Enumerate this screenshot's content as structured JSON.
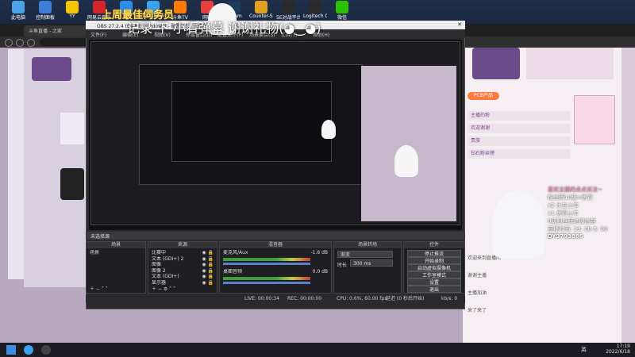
{
  "desktop_icons": [
    {
      "label": "此电脑",
      "name": "this-pc-icon",
      "color": "#4aa3e8"
    },
    {
      "label": "控制面板",
      "name": "control-panel-icon",
      "color": "#3d7fd8"
    },
    {
      "label": "YY",
      "name": "yy-icon",
      "color": "#f7c400"
    },
    {
      "label": "网易云音乐",
      "name": "netease-music-icon",
      "color": "#d8232a"
    },
    {
      "label": "",
      "name": "app-icon",
      "color": "#2a8ee8"
    },
    {
      "label": "WeGame",
      "name": "wegame-icon",
      "color": "#3aa0f0"
    },
    {
      "label": "斗鱼TV",
      "name": "douyu-icon",
      "color": "#ff7a00"
    },
    {
      "label": "网吧",
      "name": "netbar-icon",
      "color": "#e84040"
    },
    {
      "label": "Steam",
      "name": "steam-icon",
      "color": "#1b3a5c"
    },
    {
      "label": "Counter-S...",
      "name": "csgo-icon",
      "color": "#e0a020"
    },
    {
      "label": "5E对战平台",
      "name": "5e-icon",
      "color": "#2a2a2a"
    },
    {
      "label": "Logitech G",
      "name": "logitech-icon",
      "color": "#2a2a2a"
    },
    {
      "label": "微信",
      "name": "wechat-icon",
      "color": "#2dc100"
    }
  ],
  "banner": {
    "title": "上周最佳伺务员",
    "subtitle": "记录 下 小看弹幕 谢谢礼物(◕‿◕)"
  },
  "browser": {
    "tab_label": "斗鱼直播 - 之家",
    "address": ""
  },
  "obs": {
    "title": "OBS 27.2.4 (64-bit, windows) - 配置文件: 未命名 - 场景: 未命名",
    "menu": [
      "文件(F)",
      "编辑(E)",
      "视图(V)",
      "停靠窗口(D)",
      "配置文件(P)",
      "场景集合(S)",
      "工具(T)",
      "帮助(H)"
    ],
    "preview_label": "未选择源",
    "docks": {
      "scenes": {
        "title": "场景",
        "items": [
          "场景"
        ]
      },
      "sources": {
        "title": "来源",
        "items": [
          "比赛中",
          "文本 (GDI+) 2",
          "图像",
          "图像 2",
          "文本 (GDI+)",
          "显示器"
        ]
      },
      "mixer": {
        "title": "混音器",
        "channels": [
          {
            "name": "麦克风/Aux",
            "db": "-1.6 dB"
          },
          {
            "name": "桌面音频",
            "db": "0.0 dB"
          }
        ]
      },
      "transitions": {
        "title": "场景转场",
        "mode": "渐变",
        "duration_label": "时长",
        "duration": "300 ms"
      },
      "controls": {
        "title": "控件",
        "buttons": [
          "停止推流",
          "开始录制",
          "启动虚拟摄像机",
          "工作室模式",
          "设置",
          "退出"
        ]
      }
    },
    "status": {
      "live": "LIVE: 00:00:34",
      "rec": "REC: 00:00:00",
      "cpu": "CPU: 0.6%, 60.00 fps",
      "delay": "延迟 (0 秒后开始)",
      "kbps": "kb/s: 0"
    }
  },
  "chat": {
    "header_button": "PCB产品",
    "items": [
      "主播的粉",
      "欢迎谢谢",
      "贵族",
      "钻石粉丝榜"
    ],
    "messages": [
      "欢迎来到直播间",
      "谢谢主播",
      "主播加油",
      "来了来了"
    ]
  },
  "follow_overlay": {
    "title": "喜欢主播的点点关注~",
    "lines": [
      "粉丝牌10级=房管",
      "x2 水友上车",
      "x1 房管上车",
      "8级粉丝牌进微信群"
    ],
    "schedule": "直播时间: 19: 00-5: 00",
    "douyin": "DY9793886"
  },
  "taskbar": {
    "time": "17:19",
    "date": "2022/6/18",
    "lang": "英"
  }
}
